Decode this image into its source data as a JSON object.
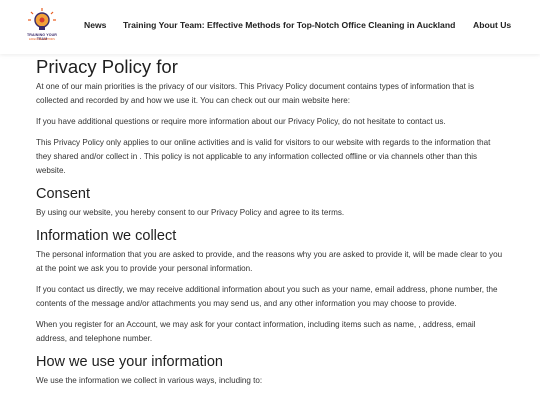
{
  "header": {
    "logo": {
      "line1": "TRAINING YOUR TEAM",
      "line2": "EFFECTIVE METHODS"
    },
    "nav": {
      "news": "News",
      "training": "Training Your Team: Effective Methods for Top-Notch Office Cleaning in Auckland",
      "about": "About Us"
    }
  },
  "main": {
    "title": "Privacy Policy for",
    "intro": [
      "At one of our main priorities is the privacy of our visitors. This Privacy Policy document contains types of information that is collected and recorded by and how we use it. You can check out our main website here:",
      "If you have additional questions or require more information about our Privacy Policy, do not hesitate to contact us.",
      "This Privacy Policy only applies to our online activities and is valid for visitors to our website with regards to the information that they shared and/or collect in . This policy is not applicable to any information collected offline or via channels other than this website."
    ],
    "consent": {
      "heading": "Consent",
      "paragraphs": [
        "By using our website, you hereby consent to our Privacy Policy and agree to its terms."
      ]
    },
    "info_collect": {
      "heading": "Information we collect",
      "paragraphs": [
        "The personal information that you are asked to provide, and the reasons why you are asked to provide it, will be made clear to you at the point we ask you to provide your personal information.",
        "If you contact us directly, we may receive additional information about you such as your name, email address, phone number, the contents of the message and/or attachments you may send us, and any other information you may choose to provide.",
        "When you register for an Account, we may ask for your contact information, including items such as name, , address, email address, and telephone number."
      ]
    },
    "how_use": {
      "heading": "How we use your information",
      "paragraphs": [
        "We use the information we collect in various ways, including to:"
      ]
    }
  }
}
